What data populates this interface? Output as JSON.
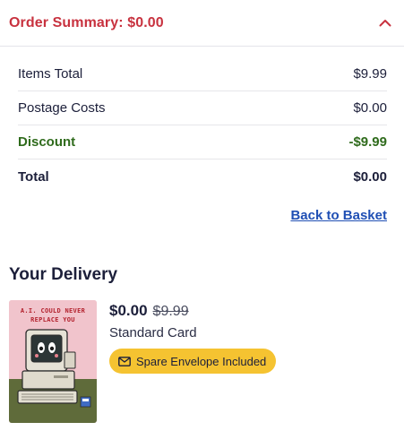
{
  "order_summary": {
    "title": "Order Summary: $0.00",
    "toggle_icon": "chevron-up-icon",
    "accent_color": "#c8323f",
    "rows": [
      {
        "label": "Items Total",
        "value": "$9.99"
      },
      {
        "label": "Postage Costs",
        "value": "$0.00"
      },
      {
        "label": "Discount",
        "value": "-$9.99"
      },
      {
        "label": "Total",
        "value": "$0.00"
      }
    ],
    "discount_color": "#2f6b1c",
    "back_link": "Back to Basket",
    "link_color": "#1f4fb4"
  },
  "delivery": {
    "heading": "Your Delivery",
    "item": {
      "card_text": "A.I. COULD NEVER REPLACE YOU",
      "price_now": "$0.00",
      "price_was": "$9.99",
      "card_type": "Standard Card",
      "badge_label": "Spare Envelope Included",
      "badge_icon": "envelope-icon",
      "badge_color": "#f5c331"
    }
  }
}
